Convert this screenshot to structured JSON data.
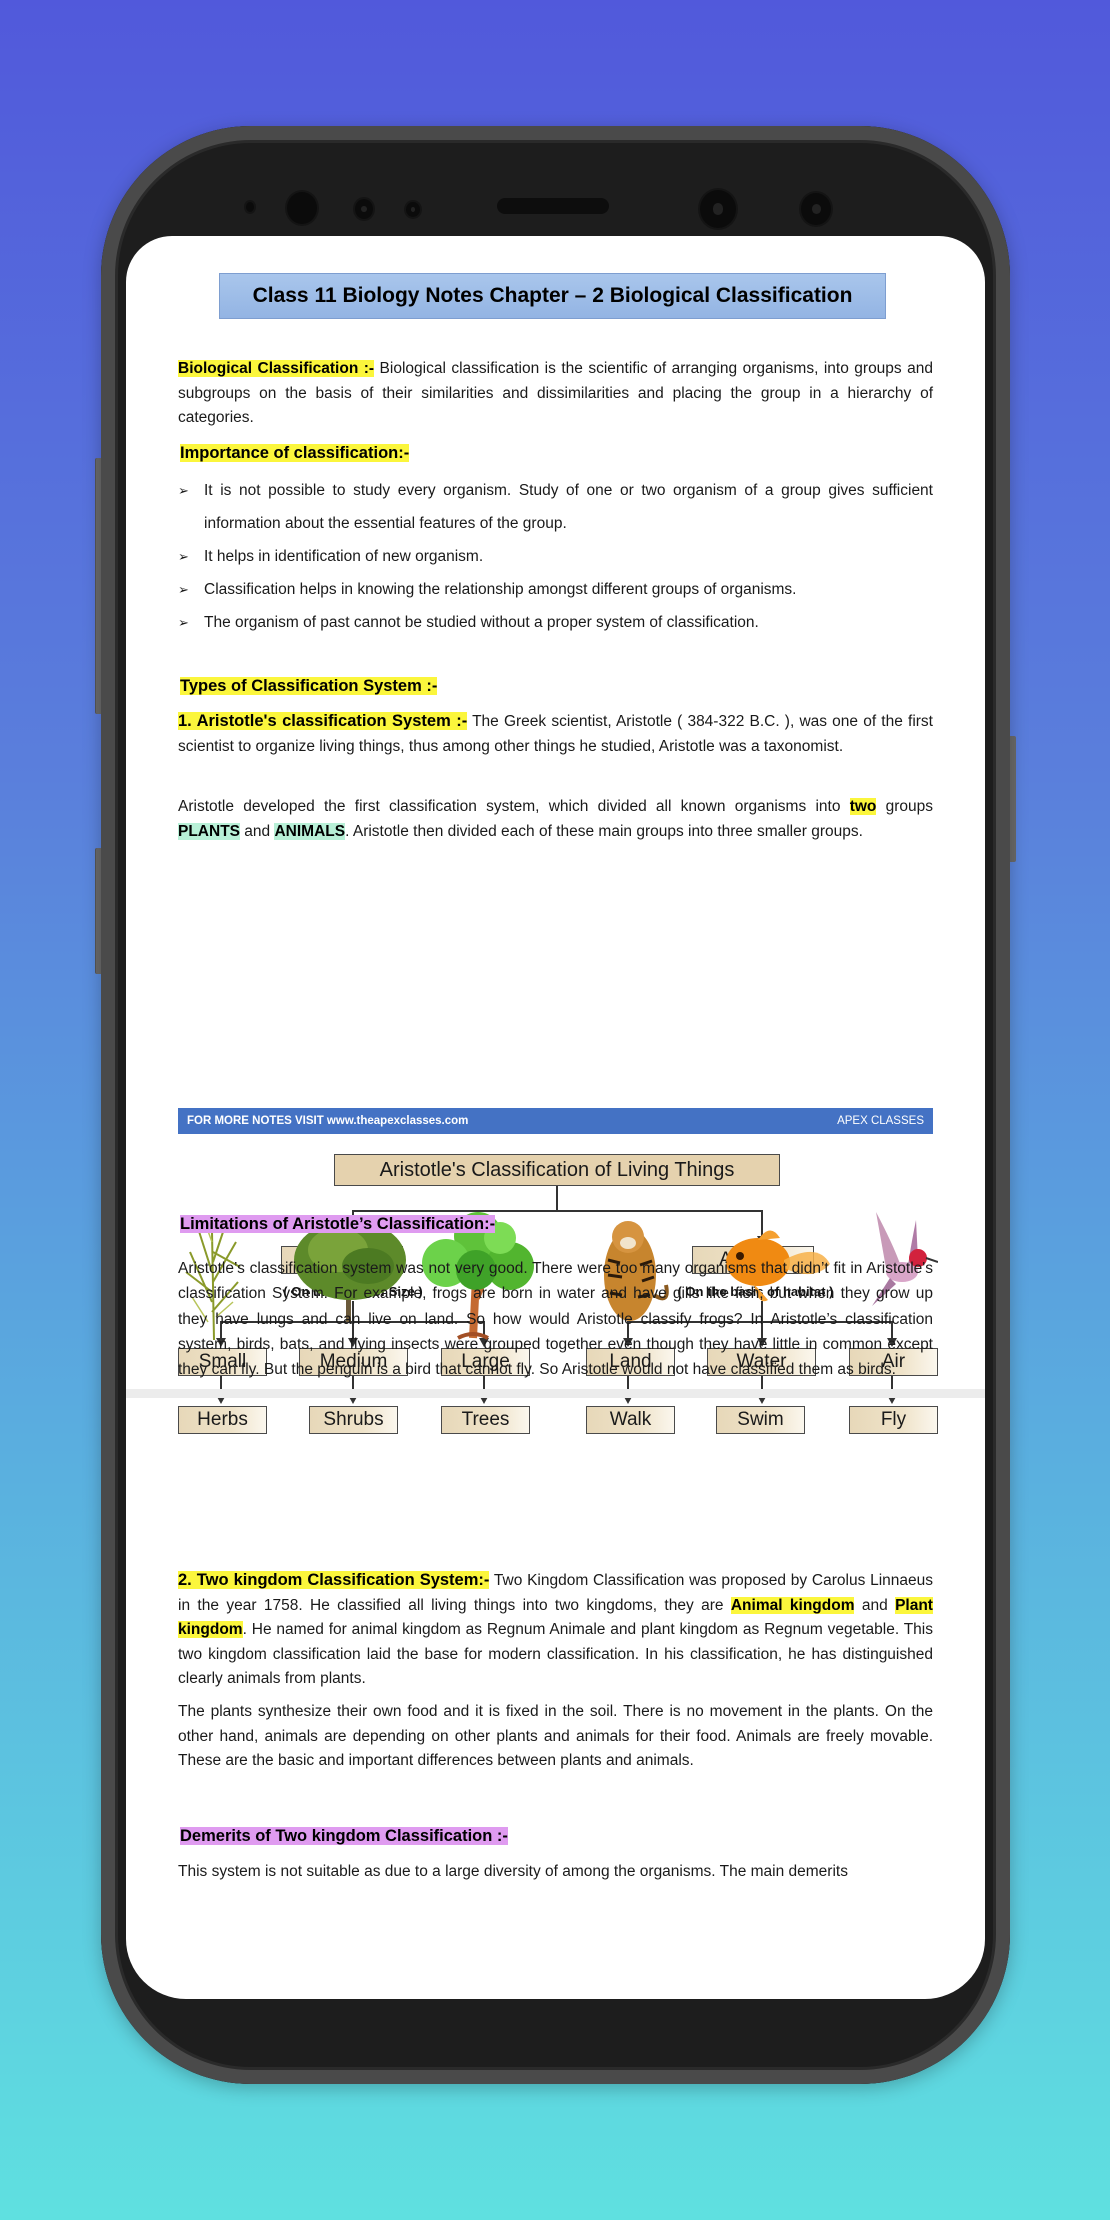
{
  "document": {
    "title": "Class 11 Biology Notes Chapter – 2 Biological Classification",
    "intro": {
      "label": "Biological Classification :-",
      "text": " Biological classification is the scientific of arranging organisms, into groups and subgroups on the basis of their similarities and dissimilarities and placing the group in a hierarchy of categories."
    },
    "importance": {
      "heading": "Importance of classification:-",
      "bullets": [
        "It is not possible to study every organism. Study of one or two organism of a group gives sufficient information about the essential features of the group.",
        "It helps in identification of new organism.",
        "Classification helps in knowing the relationship amongst different groups of organisms.",
        "The organism of past cannot be studied without a proper system of classification."
      ]
    },
    "types": {
      "heading": "Types of Classification System :-",
      "aristotle_label": "1. Aristotle's classification System :-",
      "aristotle_text": " The Greek scientist, Aristotle ( 384-322 B.C. ), was one of the first scientist to organize living things, thus among other things he studied, Aristotle was a taxonomist.",
      "para2_a": "Aristotle developed the first classification system, which divided all known organisms into ",
      "para2_two": "two",
      "para2_b": " groups ",
      "para2_plants": "PLANTS",
      "para2_and": " and ",
      "para2_animals": "ANIMALS",
      "para2_c": ". Aristotle then divided each of these main groups into three smaller groups."
    },
    "diagram": {
      "root": "Aristotle's Classification of Living Things",
      "plants": "Plants",
      "plants_basis": "( On the basis of Size )",
      "animals": "Animals",
      "animals_basis": "( On the basis of habitat )",
      "plant_groups": [
        {
          "group": "Small",
          "type": "Herbs",
          "image": "herb-plant"
        },
        {
          "group": "Medium",
          "type": "Shrubs",
          "image": "shrub"
        },
        {
          "group": "Large",
          "type": "Trees",
          "image": "tree"
        }
      ],
      "animal_groups": [
        {
          "group": "Land",
          "type": "Walk",
          "image": "tiger"
        },
        {
          "group": "Water",
          "type": "Swim",
          "image": "goldfish"
        },
        {
          "group": "Air",
          "type": "Fly",
          "image": "hummingbird"
        }
      ],
      "footer_left": "FOR MORE NOTES VISIT www.theapexclasses.com",
      "footer_right": "APEX CLASSES"
    },
    "limitations": {
      "heading": "Limitations of Aristotle’s Classification:-",
      "text": "Aristotle’s classification system was not very good. There were too many organisms that didn’t fit in Aristotle's classification System. For example, frogs are born in water and have gills like fish, but when they grow up they have lungs and can live on land. So how would Aristotle classify frogs? In Aristotle’s classification system, birds, bats, and flying insects were grouped together even though they have little in common except they can fly. But the penguin is a bird that cannot fly. So Aristotle would not have classified them as birds."
    },
    "two_kingdom": {
      "label": "2. Two kingdom Classification System:-",
      "text_a": " Two Kingdom Classification was proposed by Carolus Linnaeus in the year 1758. He classified all living things into two kingdoms, they are ",
      "animal_kingdom": "Animal kingdom",
      "text_and": " and ",
      "plant_kingdom": "Plant kingdom",
      "text_b": ". He named for animal kingdom as Regnum Animale and plant kingdom as Regnum vegetable. This two kingdom classification laid the base for modern classification. In his classification, he has distinguished clearly animals from plants.",
      "para2": "The plants synthesize their own food and it is fixed in the soil. There is no movement in the plants. On the other hand, animals are depending on other plants and animals for their food. Animals are freely movable. These are the basic and important differences between plants and animals."
    },
    "demerits": {
      "heading": "Demerits of Two kingdom Classification :-",
      "text": "This system is not suitable as due to a large diversity of among the organisms. The main demerits"
    }
  },
  "colors": {
    "highlight_yellow": "#fbf63c",
    "highlight_green": "#b8f0d7",
    "highlight_purple": "#df9bf0",
    "title_blue": "#a9c6ec",
    "footer_blue": "#4472c4"
  }
}
